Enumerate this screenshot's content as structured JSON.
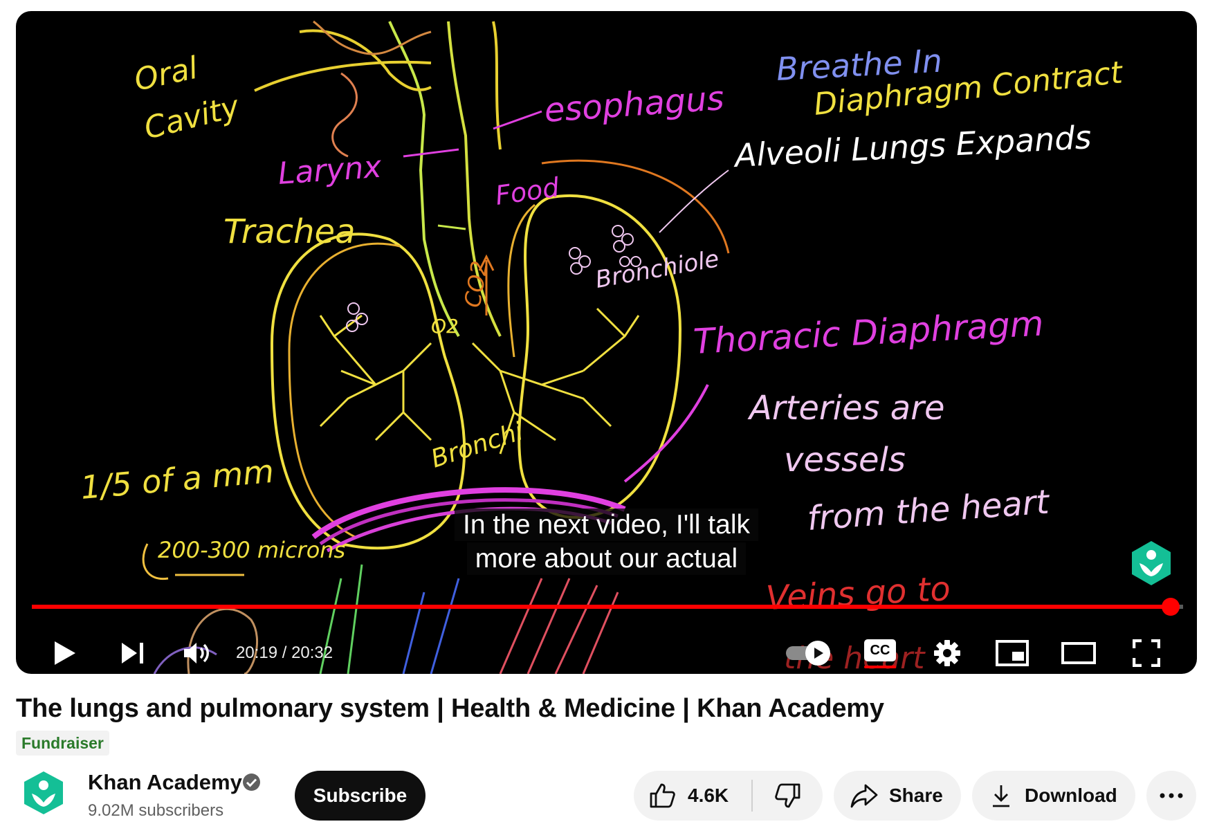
{
  "video": {
    "board_text": {
      "oral": "Oral",
      "cavity": "Cavity",
      "larynx": "Larynx",
      "trachea": "Trachea",
      "esophagus": "esophagus",
      "food": "Food",
      "breathe_in": "Breathe In",
      "diaphragm_contract": "Diaphragm Contract",
      "alveoli_lungs_expand": "Alveoli Lungs Expands",
      "bronchiole": "Bronchiole",
      "co2": "CO2",
      "o2": "O2",
      "thoracic_diaphragm": "Thoracic Diaphragm",
      "arteries_are": "Arteries are",
      "vessels": "vessels",
      "from_the_heart": "from the heart",
      "veins_go_to": "Veins go to",
      "the_heart": "the heart",
      "fifth_mm": "1/5 of a mm",
      "microns": "200-300 microns",
      "bronchi": "Bronchi"
    },
    "captions": [
      "In the next video, I'll talk",
      "more about our actual"
    ],
    "progress_fraction": 0.989,
    "time_display": "20:19 / 20:32",
    "controls": {
      "play": "play-icon",
      "next": "next-icon",
      "volume": "volume-icon",
      "autoplay": "autoplay-toggle-icon",
      "cc": "CC",
      "settings": "gear-icon",
      "miniplayer": "miniplayer-icon",
      "theater": "theater-icon",
      "fullscreen": "fullscreen-icon"
    }
  },
  "title": "The lungs and pulmonary system | Health & Medicine | Khan Academy",
  "badge": "Fundraiser",
  "channel": {
    "name": "Khan Academy",
    "subscribers": "9.02M subscribers",
    "verified": true
  },
  "actions": {
    "subscribe": "Subscribe",
    "likes": "4.6K",
    "share": "Share",
    "download": "Download",
    "more": "more-icon"
  },
  "colors": {
    "progress": "#ff0000",
    "subscribe_bg": "#0f0f0f",
    "pill_bg": "#f2f2f2",
    "fundraiser_text": "#2a7a2a",
    "ka_green": "#14bf96"
  }
}
